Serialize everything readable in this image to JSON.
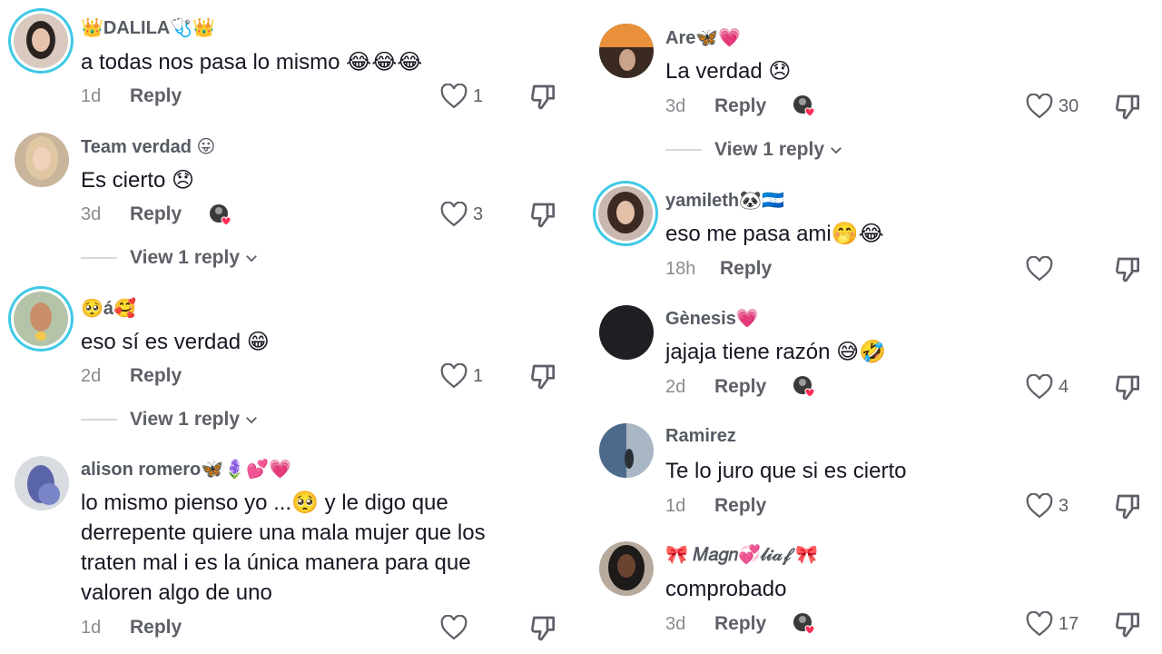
{
  "comments_left": [
    {
      "username": "👑DALILA🩺👑",
      "text": "a todas nos pasa lo mismo 😂😂😂",
      "age": "1d",
      "reply_label": "Reply",
      "likes": "1",
      "creator_liked": false
    },
    {
      "username": "Team verdad 😛",
      "text": "Es cierto 😞",
      "age": "3d",
      "reply_label": "Reply",
      "likes": "3",
      "creator_liked": true,
      "view_replies": "View 1 reply"
    },
    {
      "username": "🥺á🥰",
      "text": "eso sí es verdad 😁",
      "age": "2d",
      "reply_label": "Reply",
      "likes": "1",
      "creator_liked": false,
      "view_replies": "View 1 reply"
    },
    {
      "username": "alison romero🦋🪻💕💗",
      "text_lines": [
        "lo mismo pienso yo ...🥺 y le digo que",
        "derrepente quiere una mala mujer que los",
        "traten mal i es la única manera para que",
        "valoren algo de uno"
      ],
      "age": "1d",
      "reply_label": "Reply",
      "likes": "",
      "creator_liked": false
    }
  ],
  "comments_right": [
    {
      "username": "Are🦋💗",
      "text": "La verdad 😞",
      "age": "3d",
      "reply_label": "Reply",
      "likes": "30",
      "creator_liked": true,
      "view_replies": "View 1 reply"
    },
    {
      "username": "yamileth🐼🇭🇳",
      "text": "eso me pasa ami🤭😂",
      "age": "18h",
      "reply_label": "Reply",
      "likes": "",
      "creator_liked": false
    },
    {
      "username": "Gènesis💗",
      "text": "jajaja tiene razón 😅🤣",
      "age": "2d",
      "reply_label": "Reply",
      "likes": "4",
      "creator_liked": true
    },
    {
      "username": "Ramirez",
      "text": "Te lo juro que si es cierto",
      "age": "1d",
      "reply_label": "Reply",
      "likes": "3",
      "creator_liked": false
    },
    {
      "username": "🎀 𝑀𝑎𝑔𝑛💞𝓁𝒾𝒶𝒻 🎀",
      "text": "comprobado",
      "age": "3d",
      "reply_label": "Reply",
      "likes": "17",
      "creator_liked": true
    }
  ],
  "icons": {
    "like": "heart-outline-icon",
    "dislike": "thumbs-down-icon",
    "chevron": "chevron-down-icon",
    "creator_like": "creator-liked-avatar-icon"
  },
  "colors": {
    "ring": "#3ec9e6",
    "heart_red": "#fe2c55",
    "text": "#161823",
    "muted": "#8a8b91"
  }
}
